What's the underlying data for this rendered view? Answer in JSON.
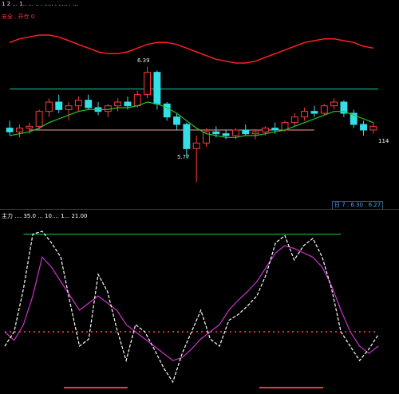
{
  "header": {
    "row1": "1 2 ... 1.. ... .. . ..... . ..... . ...",
    "row2": "安全 . 开仓 0"
  },
  "main_panel": {
    "label_high": "6.39",
    "label_low": "5.77",
    "label_right": "114",
    "info_box": "日 7 . 6.30 . 6.27"
  },
  "sub_panel": {
    "title": "主力 .... 35.0 ... 10.... 1... 21.00"
  },
  "colors": {
    "up": "#ff3b3b",
    "down": "#34e0e8",
    "ma": "#e8e800",
    "ma_green": "#2ec42e",
    "red_curve": "#ff2020",
    "magenta": "#ff2cff",
    "green_line": "#22cc44",
    "white": "#ffffff",
    "sub_magenta": "#cc33cc",
    "dots_red": "#ff4444",
    "pink_bottom": "#ff3333"
  },
  "chart_data": [
    {
      "type": "candlestick",
      "candles": [
        [
          6.06,
          6.1,
          6.02,
          6.04
        ],
        [
          6.04,
          6.08,
          6.01,
          6.06
        ],
        [
          6.06,
          6.09,
          6.03,
          6.07
        ],
        [
          6.07,
          6.16,
          6.05,
          6.15
        ],
        [
          6.15,
          6.22,
          6.12,
          6.2
        ],
        [
          6.2,
          6.24,
          6.14,
          6.16
        ],
        [
          6.16,
          6.2,
          6.1,
          6.18
        ],
        [
          6.18,
          6.23,
          6.15,
          6.21
        ],
        [
          6.21,
          6.24,
          6.16,
          6.17
        ],
        [
          6.17,
          6.2,
          6.13,
          6.15
        ],
        [
          6.15,
          6.19,
          6.12,
          6.18
        ],
        [
          6.18,
          6.22,
          6.15,
          6.2
        ],
        [
          6.2,
          6.23,
          6.16,
          6.18
        ],
        [
          6.18,
          6.26,
          6.17,
          6.24
        ],
        [
          6.24,
          6.39,
          6.22,
          6.36
        ],
        [
          6.36,
          6.37,
          6.16,
          6.19
        ],
        [
          6.19,
          6.2,
          6.1,
          6.12
        ],
        [
          6.12,
          6.14,
          6.05,
          6.08
        ],
        [
          6.08,
          6.09,
          5.9,
          5.95
        ],
        [
          5.95,
          6.02,
          5.77,
          5.98
        ],
        [
          5.98,
          6.06,
          5.96,
          6.04
        ],
        [
          6.04,
          6.07,
          6.01,
          6.03
        ],
        [
          6.03,
          6.05,
          6.0,
          6.02
        ],
        [
          6.02,
          6.06,
          6.0,
          6.05
        ],
        [
          6.05,
          6.08,
          6.02,
          6.03
        ],
        [
          6.03,
          6.05,
          6.0,
          6.04
        ],
        [
          6.04,
          6.07,
          6.02,
          6.06
        ],
        [
          6.06,
          6.09,
          6.03,
          6.05
        ],
        [
          6.05,
          6.1,
          6.04,
          6.09
        ],
        [
          6.09,
          6.14,
          6.07,
          6.12
        ],
        [
          6.12,
          6.17,
          6.1,
          6.15
        ],
        [
          6.15,
          6.18,
          6.12,
          6.14
        ],
        [
          6.14,
          6.19,
          6.13,
          6.18
        ],
        [
          6.18,
          6.22,
          6.16,
          6.2
        ],
        [
          6.2,
          6.21,
          6.12,
          6.14
        ],
        [
          6.14,
          6.16,
          6.06,
          6.08
        ],
        [
          6.08,
          6.1,
          6.02,
          6.05
        ],
        [
          6.05,
          6.09,
          6.03,
          6.07
        ]
      ],
      "ma": [
        6.02,
        6.03,
        6.04,
        6.06,
        6.09,
        6.11,
        6.13,
        6.15,
        6.16,
        6.16,
        6.16,
        6.17,
        6.17,
        6.18,
        6.2,
        6.19,
        6.17,
        6.14,
        6.1,
        6.06,
        6.03,
        6.02,
        6.01,
        6.01,
        6.02,
        6.02,
        6.03,
        6.04,
        6.05,
        6.07,
        6.09,
        6.11,
        6.13,
        6.15,
        6.15,
        6.13,
        6.11,
        6.09
      ],
      "red_curve": [
        6.52,
        6.54,
        6.55,
        6.56,
        6.56,
        6.55,
        6.53,
        6.51,
        6.49,
        6.47,
        6.46,
        6.46,
        6.47,
        6.49,
        6.51,
        6.52,
        6.52,
        6.51,
        6.49,
        6.47,
        6.45,
        6.43,
        6.42,
        6.41,
        6.41,
        6.42,
        6.44,
        6.46,
        6.48,
        6.5,
        6.52,
        6.53,
        6.54,
        6.54,
        6.53,
        6.52,
        6.5,
        6.49
      ],
      "resistance": 6.27,
      "support": 6.05,
      "ylim": [
        5.72,
        6.62
      ]
    },
    {
      "type": "line",
      "white": [
        20,
        30,
        60,
        98,
        100,
        92,
        82,
        50,
        20,
        25,
        70,
        58,
        32,
        10,
        35,
        30,
        18,
        5,
        -5,
        15,
        30,
        45,
        25,
        20,
        38,
        42,
        48,
        55,
        70,
        92,
        97,
        80,
        90,
        95,
        82,
        60,
        30,
        20,
        10,
        18,
        28
      ],
      "magenta": [
        30,
        24,
        35,
        55,
        82,
        75,
        65,
        55,
        45,
        50,
        55,
        50,
        45,
        35,
        30,
        25,
        20,
        15,
        10,
        12,
        18,
        25,
        30,
        35,
        45,
        52,
        58,
        65,
        75,
        85,
        90,
        88,
        85,
        82,
        75,
        62,
        45,
        30,
        20,
        15,
        20
      ],
      "green_level": 98,
      "dots_level": 30,
      "ylim": [
        -10,
        110
      ]
    }
  ]
}
